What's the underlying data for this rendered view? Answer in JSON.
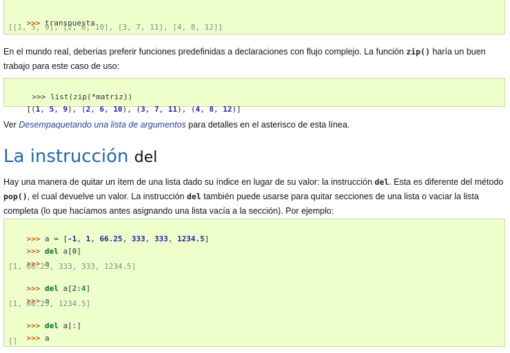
{
  "block1": {
    "prompt": ">>>",
    "cmd": "transpuesta",
    "output": "[[1, 5, 9], [2, 6, 10], [3, 7, 11], [4, 8, 12]]"
  },
  "para1": {
    "text_a": "En el mundo real, deberías preferir funciones predefinidas a declaraciones con flujo complejo. La función ",
    "func": "zip()",
    "text_b": " haría un buen trabajo para este caso de uso:"
  },
  "block2": {
    "prompt": ">>>",
    "cmd": "list(zip(*matriz))",
    "out_open": "[",
    "tuples": [
      [
        "1",
        "5",
        "9"
      ],
      [
        "2",
        "6",
        "10"
      ],
      [
        "3",
        "7",
        "11"
      ],
      [
        "4",
        "8",
        "12"
      ]
    ],
    "out_close": "]"
  },
  "para2": {
    "text_a": "Ver ",
    "link": "Desempaquetando una lista de argumentos",
    "text_b": " para detalles en el asterisco de esta línea."
  },
  "heading": {
    "title": "La instrucción ",
    "keyword": "del"
  },
  "para3": {
    "text_a": "Hay una manera de quitar un ítem de una lista dado su índice en lugar de su valor: la instrucción ",
    "del1": "del",
    "text_b": ". Esta es diferente del método ",
    "pop": "pop()",
    "text_c": ", el cual devuelve un valor. La instrucción ",
    "del2": "del",
    "text_d": " también puede usarse para quitar secciones de una lista o vaciar la lista completa (lo que hacíamos antes asignando una lista vacía a la sección). Por ejemplo:"
  },
  "block3": {
    "prompt": ">>>",
    "l1_pre": "a = [",
    "l1_vals": [
      "-1",
      "1",
      "66.25",
      "333",
      "333",
      "1234.5"
    ],
    "l1_post": "]",
    "kw_del": "del",
    "l2_var": " a[",
    "l2_idx": "0",
    "l2_close": "]",
    "l3": "a",
    "o3": "[1, 66.25, 333, 333, 1234.5]",
    "l4_var": " a[",
    "l4_idx": "2:4",
    "l4_close": "]",
    "l5": "a",
    "o5": "[1, 66.25, 1234.5]",
    "l6": " a[:]",
    "l7": "a",
    "o7": "[]"
  }
}
